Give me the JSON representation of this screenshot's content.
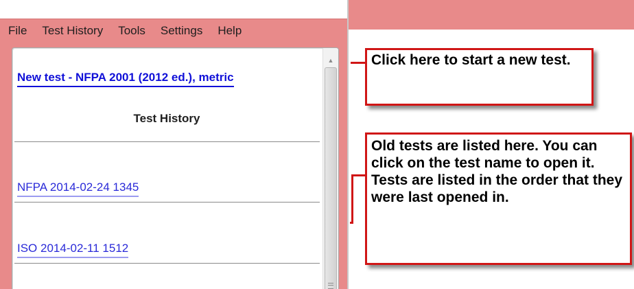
{
  "menu": {
    "items": [
      "File",
      "Test History",
      "Tools",
      "Settings",
      "Help"
    ]
  },
  "panel": {
    "new_test_link": "New test - NFPA 2001 (2012 ed.), metric",
    "heading": "Test History",
    "history": [
      {
        "name": "NFPA 2014-02-24 1345"
      },
      {
        "name": "ISO 2014-02-11 1512"
      }
    ]
  },
  "callouts": {
    "new_test": "Click here to start a new test.",
    "old_tests": "Old tests are listed here. You can click on the test name to open it. Tests are listed in the order that they were last opened in."
  },
  "colors": {
    "title_bar": "#e88a8a",
    "callout_border": "#d01616",
    "link": "#1010d8"
  },
  "icons": {
    "scroll_up": "triangle-up",
    "scroll_grip": "three-lines"
  }
}
